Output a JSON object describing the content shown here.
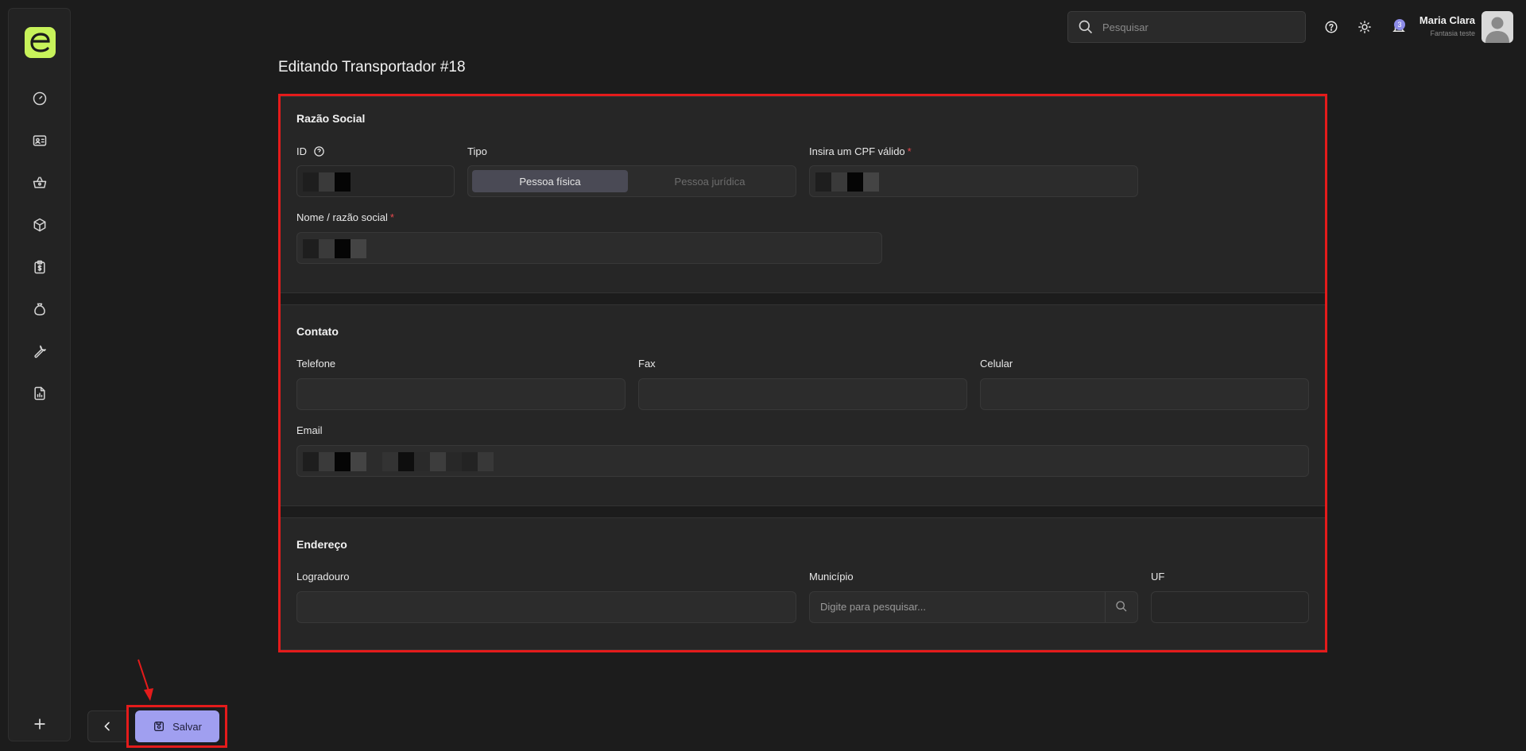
{
  "header": {
    "search_placeholder": "Pesquisar",
    "notification_count": "3",
    "user_name": "Maria Clara",
    "user_company": "Fantasia teste"
  },
  "sidebar": {
    "items": [
      "dashboard-icon",
      "contacts-card-icon",
      "basket-icon",
      "box-icon",
      "clipboard-dollar-icon",
      "money-bag-icon",
      "wrench-icon",
      "report-icon"
    ]
  },
  "page": {
    "title": "Editando Transportador #18"
  },
  "sections": {
    "razao": {
      "title": "Razão Social",
      "id_label": "ID",
      "tipo_label": "Tipo",
      "tipo_options": [
        "Pessoa física",
        "Pessoa jurídica"
      ],
      "cpf_label": "Insira um CPF válido",
      "nome_label": "Nome / razão social"
    },
    "contato": {
      "title": "Contato",
      "telefone_label": "Telefone",
      "fax_label": "Fax",
      "celular_label": "Celular",
      "email_label": "Email"
    },
    "endereco": {
      "title": "Endereço",
      "logradouro_label": "Logradouro",
      "municipio_label": "Município",
      "municipio_placeholder": "Digite para pesquisar...",
      "uf_label": "UF"
    }
  },
  "footer": {
    "save_label": "Salvar"
  },
  "colors": {
    "accent": "#a09ff0",
    "brand": "#c7f25a",
    "highlight": "#e41b1b"
  }
}
